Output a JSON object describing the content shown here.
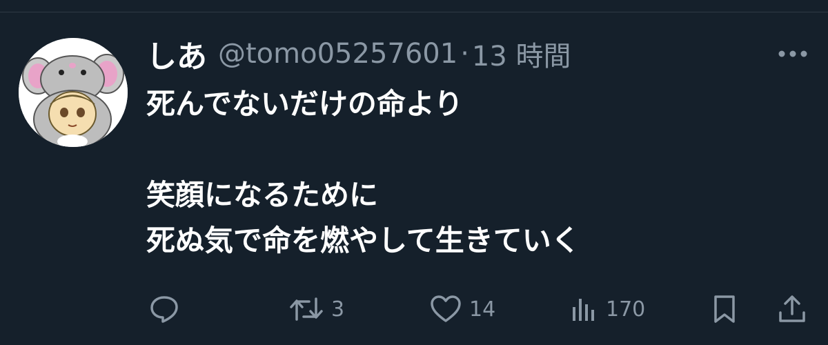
{
  "tweet": {
    "display_name": "しあ",
    "handle": "@tomo05257601",
    "separator": "·",
    "timestamp": "13 時間",
    "text_lines": [
      "死んでないだけの命より",
      "",
      "笑顔になるために",
      "死ぬ気で命を燃やして生きていく"
    ]
  },
  "actions": {
    "reply": {
      "icon": "reply-icon"
    },
    "retweet": {
      "icon": "retweet-icon",
      "count": "3"
    },
    "like": {
      "icon": "heart-icon",
      "count": "14"
    },
    "views": {
      "icon": "views-icon",
      "count": "170"
    },
    "bookmark": {
      "icon": "bookmark-icon"
    },
    "share": {
      "icon": "share-icon"
    }
  },
  "colors": {
    "background": "#15202b",
    "text": "#ffffff",
    "muted": "#8b98a5"
  }
}
